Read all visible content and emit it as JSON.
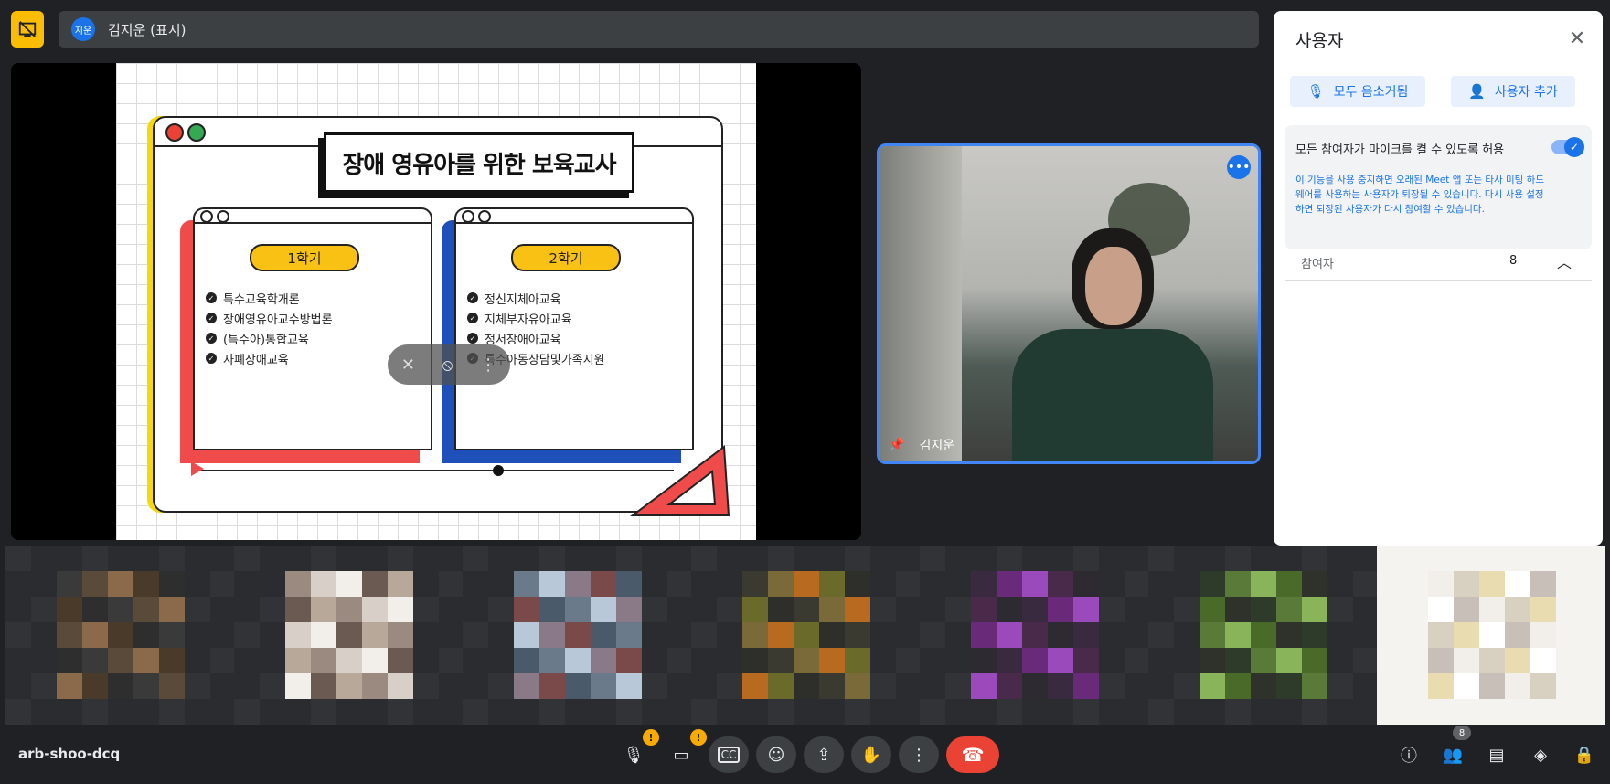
{
  "topbar": {
    "presenter_avatar": "지운",
    "presenter_label": "김지운 (표시)",
    "icon": "stop-presenting-icon"
  },
  "slide": {
    "title": "장애 영유아를 위한 보육교사",
    "term1": {
      "label": "1학기",
      "items": [
        "특수교육학개론",
        "장애영유아교수방법론",
        "(특수아)통합교육",
        "자폐장애교육"
      ]
    },
    "term2": {
      "label": "2학기",
      "items": [
        "정신지체아교육",
        "지체부자유아교육",
        "정서장애아교육",
        "특수아동상담및가족지원"
      ]
    },
    "colors": {
      "red": "#ef4b4b",
      "blue": "#1f4fb8",
      "yellow": "#f9c114"
    }
  },
  "speaker": {
    "name": "김지운",
    "more_icon": "more-options-icon",
    "pin_icon": "pin-icon"
  },
  "panel": {
    "title": "사용자",
    "mute_all": "모두 음소거됨",
    "add_people": "사용자 추가",
    "allow_mic_label": "모든 참여자가 마이크를 켤 수 있도록 허용",
    "allow_mic_desc": "이 기능을 사용 중지하면 오래된 Meet 앱 또는 타사 미팅 하드웨어를 사용하는 사용자가 퇴장될 수 있습니다. 다시 사용 설정하면 퇴장된 사용자가 다시 참여할 수 있습니다.",
    "participants_label": "참여자",
    "participants_count": "8"
  },
  "bottombar": {
    "meeting_code": "arb-shoo-dcq",
    "warning_badge": "!",
    "people_count": "8",
    "accent": "#1a73e8",
    "end_call_color": "#ea4335"
  }
}
